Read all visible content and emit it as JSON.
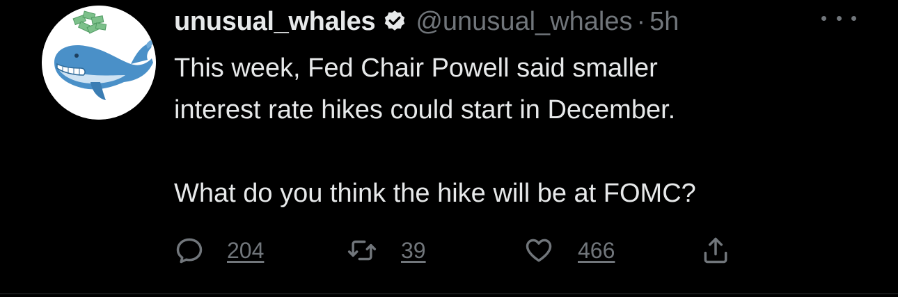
{
  "author": {
    "display_name": "unusual_whales",
    "handle": "@unusual_whales",
    "separator": "·",
    "time": "5h",
    "verified": true,
    "avatar_icon": "whale-avatar-icon"
  },
  "tweet": {
    "line1": "This week, Fed Chair Powell said smaller",
    "line2": "interest rate hikes could start in December.",
    "line3": "What do you think the hike will be at FOMC?"
  },
  "actions": {
    "reply_count": "204",
    "retweet_count": "39",
    "like_count": "466"
  },
  "colors": {
    "background": "#000000",
    "primary_text": "#e7e9ea",
    "secondary_text": "#71767b",
    "whale_blue": "#4a90c8"
  }
}
